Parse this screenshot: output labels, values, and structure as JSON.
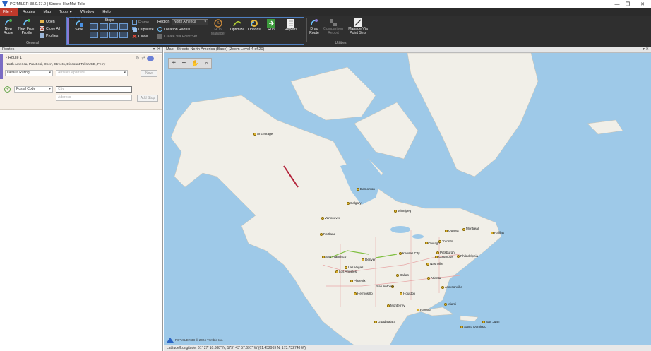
{
  "window": {
    "title": "PC*MILER 38.0.17.0 | Streets-HazMat-Tolls",
    "minimize": "—",
    "restore": "❐",
    "close": "✕"
  },
  "menu": {
    "items": [
      "File",
      "Routes",
      "Map",
      "Tools",
      "Window",
      "Help"
    ],
    "file_arrow": "▾",
    "tools_dot": "●"
  },
  "ribbon": {
    "general": {
      "new_route": "New Route",
      "new_from_profile": "New From Profile",
      "open": "Open",
      "close_all": "Close All",
      "profiles": "Profiles",
      "group_label": "General"
    },
    "route": {
      "save": "Save",
      "stops_label": "Stops",
      "frame": "Frame",
      "duplicate": "Duplicate",
      "close": "Close",
      "region_label": "Region",
      "region_value": "North America",
      "location_radius": "Location Radius",
      "create_via": "Create Via Point Set",
      "hos_manager": "HOS Manager",
      "optimize": "Optimize",
      "options": "Options",
      "run": "Run",
      "reports": "Reports",
      "group_label": "Route 1"
    },
    "utilities": {
      "drag_route": "Drag Route",
      "comparison_report": "Comparison Report",
      "manage_via": "Manage Via Point Sets",
      "group_label": "Utilities"
    }
  },
  "routes_panel": {
    "title": "Routes",
    "route_name": "Route 1",
    "route_desc": "North America, Practical, Open, Streets, Discount Tolls USD, Ferry",
    "rating": "Default Rating",
    "arrival_placeholder": "Arrival/Departure",
    "now_btn": "Now",
    "postal": "Postal Code",
    "city_placeholder": "City",
    "address_placeholder": "Address",
    "add_stop": "Add Stop",
    "add_icon": "+"
  },
  "map_panel": {
    "title": "Map - Streets North America (Base) (Zoom Level 4 of 20)",
    "status": "Latitude/Longitude: 61° 27' 10.688\" N, 173° 43' 57.691\" W (61.452969 N, 173.732748 W)",
    "logo_text": "PC*MILER 38  © 2024 Trimble Inc."
  },
  "map_labels": [
    {
      "name": "Anchorage",
      "t": "Anchorage"
    },
    {
      "name": "Edmonton",
      "t": "Edmonton"
    },
    {
      "name": "Calgary",
      "t": "Calgary"
    },
    {
      "name": "Winnipeg",
      "t": "Winnipeg"
    },
    {
      "name": "Vancouver",
      "t": "Vancouver"
    },
    {
      "name": "Portland",
      "t": "Portland"
    },
    {
      "name": "Montreal",
      "t": "Montreal"
    },
    {
      "name": "Ottawa",
      "t": "Ottawa"
    },
    {
      "name": "Halifax",
      "t": "Halifax"
    },
    {
      "name": "Toronto",
      "t": "Toronto"
    },
    {
      "name": "Chicago",
      "t": "Chicago"
    },
    {
      "name": "Pittsburgh",
      "t": "Pittsburgh"
    },
    {
      "name": "Philadelphia",
      "t": "Philadelphia"
    },
    {
      "name": "Columbus",
      "t": "Columbus"
    },
    {
      "name": "Denver",
      "t": "Denver"
    },
    {
      "name": "Kansas City",
      "t": "Kansas City"
    },
    {
      "name": "San Francisco",
      "t": "San Francisco"
    },
    {
      "name": "Las Vegas",
      "t": "Las Vegas"
    },
    {
      "name": "Los Angeles",
      "t": "Los Angeles"
    },
    {
      "name": "Phoenix",
      "t": "Phoenix"
    },
    {
      "name": "Dallas",
      "t": "Dallas"
    },
    {
      "name": "Houston",
      "t": "Houston"
    },
    {
      "name": "San Antonio",
      "t": "San Antonio"
    },
    {
      "name": "Nashville",
      "t": "Nashville"
    },
    {
      "name": "Atlanta",
      "t": "Atlanta"
    },
    {
      "name": "Jacksonville",
      "t": "Jacksonville"
    },
    {
      "name": "Miami",
      "t": "Miami"
    },
    {
      "name": "Hermosillo",
      "t": "Hermosillo"
    },
    {
      "name": "Monterrey",
      "t": "Monterrey"
    },
    {
      "name": "Guadalajara",
      "t": "Guadalajara"
    },
    {
      "name": "Havana",
      "t": "Havana"
    },
    {
      "name": "San Juan",
      "t": "San Juan"
    },
    {
      "name": "Santo Domingo",
      "t": "Santo Domingo"
    }
  ]
}
